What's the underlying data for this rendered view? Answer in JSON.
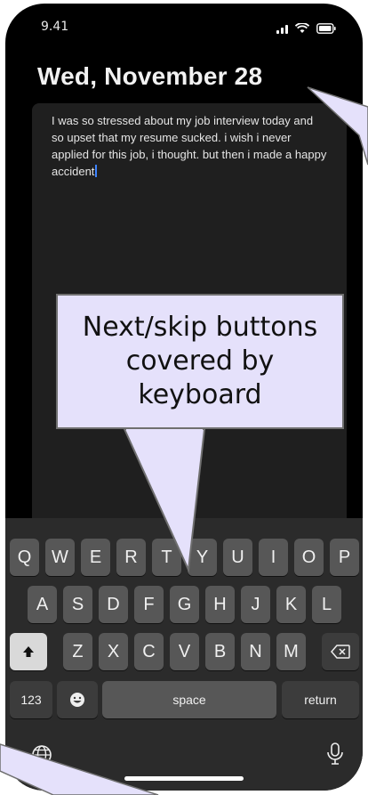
{
  "status_bar": {
    "time": "9.41",
    "icons": [
      "signal-icon",
      "wifi-icon",
      "battery-icon"
    ]
  },
  "journal": {
    "date_title": "Wed, November 28",
    "entry_text": "I was so stressed about my job interview today and so upset that my resume sucked. i wish i never applied for this job, i thought. but then i made a happy accident"
  },
  "keyboard": {
    "row1": [
      "Q",
      "W",
      "E",
      "R",
      "T",
      "Y",
      "U",
      "I",
      "O",
      "P"
    ],
    "row2": [
      "A",
      "S",
      "D",
      "F",
      "G",
      "H",
      "J",
      "K",
      "L"
    ],
    "row3": [
      "Z",
      "X",
      "C",
      "V",
      "B",
      "N",
      "M"
    ],
    "numbers_key": "123",
    "space_key": "space",
    "return_key": "return",
    "icons": [
      "shift-icon",
      "backspace-icon",
      "emoji-icon",
      "globe-icon",
      "microphone-icon"
    ]
  },
  "annotation": {
    "callout_text": "Next/skip buttons covered by keyboard",
    "callout_color": "#e5e1fb"
  }
}
